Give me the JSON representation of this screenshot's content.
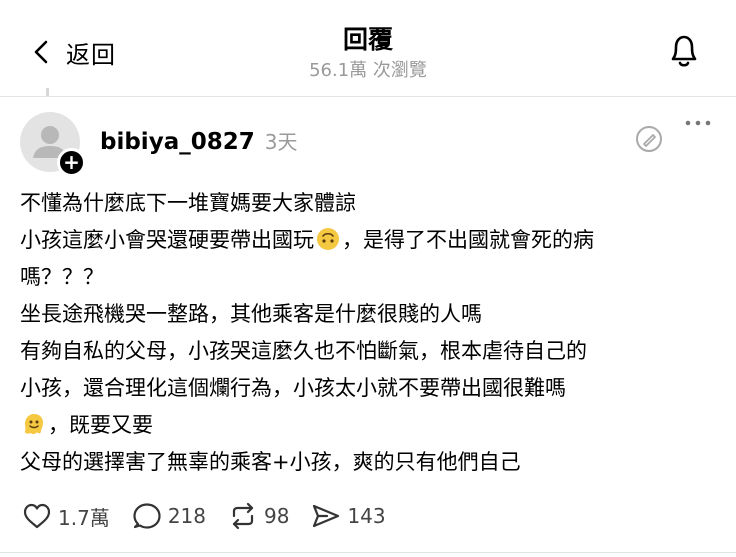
{
  "header": {
    "back_label": "返回",
    "title": "回覆",
    "views": "56.1萬 次瀏覽"
  },
  "post": {
    "username": "bibiya_0827",
    "time": "3天",
    "lines": [
      "不懂為什麼底下一堆寶媽要大家體諒",
      "小孩這麼小會哭還硬要帶出國玩",
      "，是得了不出國就會死的病",
      "嗎？？？",
      "坐長途飛機哭一整路，其他乘客是什麼很賤的人嗎",
      "有夠自私的父母，小孩哭這麼久也不怕斷氣，根本虐待自己的",
      "小孩，還合理化這個爛行為，小孩太小就不要帶出國很難嗎",
      "，既要又要",
      "父母的選擇害了無辜的乘客+小孩，爽的只有他們自己"
    ],
    "emojis": [
      "upside-down-face-emoji",
      "melting-face-emoji"
    ]
  },
  "actions": {
    "likes": "1.7萬",
    "replies": "218",
    "reposts": "98",
    "shares": "143"
  },
  "icons": [
    "chevron-left-icon",
    "bell-icon",
    "more-icon",
    "edit-icon",
    "heart-icon",
    "comment-icon",
    "repost-icon",
    "share-icon"
  ],
  "colors": {
    "muted": "#9a9a9a",
    "emoji": "#f5c842"
  }
}
